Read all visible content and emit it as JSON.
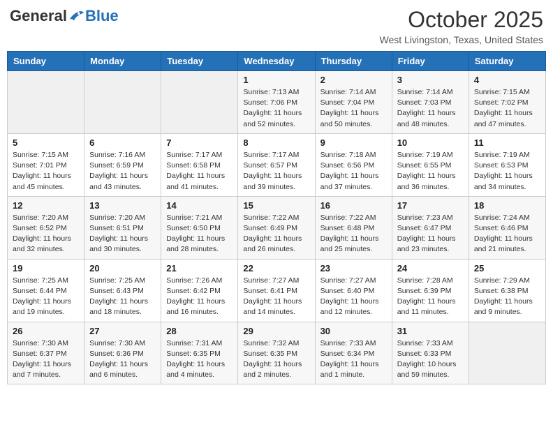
{
  "header": {
    "logo_general": "General",
    "logo_blue": "Blue",
    "month": "October 2025",
    "location": "West Livingston, Texas, United States"
  },
  "weekdays": [
    "Sunday",
    "Monday",
    "Tuesday",
    "Wednesday",
    "Thursday",
    "Friday",
    "Saturday"
  ],
  "weeks": [
    [
      {
        "day": "",
        "info": ""
      },
      {
        "day": "",
        "info": ""
      },
      {
        "day": "",
        "info": ""
      },
      {
        "day": "1",
        "info": "Sunrise: 7:13 AM\nSunset: 7:06 PM\nDaylight: 11 hours and 52 minutes."
      },
      {
        "day": "2",
        "info": "Sunrise: 7:14 AM\nSunset: 7:04 PM\nDaylight: 11 hours and 50 minutes."
      },
      {
        "day": "3",
        "info": "Sunrise: 7:14 AM\nSunset: 7:03 PM\nDaylight: 11 hours and 48 minutes."
      },
      {
        "day": "4",
        "info": "Sunrise: 7:15 AM\nSunset: 7:02 PM\nDaylight: 11 hours and 47 minutes."
      }
    ],
    [
      {
        "day": "5",
        "info": "Sunrise: 7:15 AM\nSunset: 7:01 PM\nDaylight: 11 hours and 45 minutes."
      },
      {
        "day": "6",
        "info": "Sunrise: 7:16 AM\nSunset: 6:59 PM\nDaylight: 11 hours and 43 minutes."
      },
      {
        "day": "7",
        "info": "Sunrise: 7:17 AM\nSunset: 6:58 PM\nDaylight: 11 hours and 41 minutes."
      },
      {
        "day": "8",
        "info": "Sunrise: 7:17 AM\nSunset: 6:57 PM\nDaylight: 11 hours and 39 minutes."
      },
      {
        "day": "9",
        "info": "Sunrise: 7:18 AM\nSunset: 6:56 PM\nDaylight: 11 hours and 37 minutes."
      },
      {
        "day": "10",
        "info": "Sunrise: 7:19 AM\nSunset: 6:55 PM\nDaylight: 11 hours and 36 minutes."
      },
      {
        "day": "11",
        "info": "Sunrise: 7:19 AM\nSunset: 6:53 PM\nDaylight: 11 hours and 34 minutes."
      }
    ],
    [
      {
        "day": "12",
        "info": "Sunrise: 7:20 AM\nSunset: 6:52 PM\nDaylight: 11 hours and 32 minutes."
      },
      {
        "day": "13",
        "info": "Sunrise: 7:20 AM\nSunset: 6:51 PM\nDaylight: 11 hours and 30 minutes."
      },
      {
        "day": "14",
        "info": "Sunrise: 7:21 AM\nSunset: 6:50 PM\nDaylight: 11 hours and 28 minutes."
      },
      {
        "day": "15",
        "info": "Sunrise: 7:22 AM\nSunset: 6:49 PM\nDaylight: 11 hours and 26 minutes."
      },
      {
        "day": "16",
        "info": "Sunrise: 7:22 AM\nSunset: 6:48 PM\nDaylight: 11 hours and 25 minutes."
      },
      {
        "day": "17",
        "info": "Sunrise: 7:23 AM\nSunset: 6:47 PM\nDaylight: 11 hours and 23 minutes."
      },
      {
        "day": "18",
        "info": "Sunrise: 7:24 AM\nSunset: 6:46 PM\nDaylight: 11 hours and 21 minutes."
      }
    ],
    [
      {
        "day": "19",
        "info": "Sunrise: 7:25 AM\nSunset: 6:44 PM\nDaylight: 11 hours and 19 minutes."
      },
      {
        "day": "20",
        "info": "Sunrise: 7:25 AM\nSunset: 6:43 PM\nDaylight: 11 hours and 18 minutes."
      },
      {
        "day": "21",
        "info": "Sunrise: 7:26 AM\nSunset: 6:42 PM\nDaylight: 11 hours and 16 minutes."
      },
      {
        "day": "22",
        "info": "Sunrise: 7:27 AM\nSunset: 6:41 PM\nDaylight: 11 hours and 14 minutes."
      },
      {
        "day": "23",
        "info": "Sunrise: 7:27 AM\nSunset: 6:40 PM\nDaylight: 11 hours and 12 minutes."
      },
      {
        "day": "24",
        "info": "Sunrise: 7:28 AM\nSunset: 6:39 PM\nDaylight: 11 hours and 11 minutes."
      },
      {
        "day": "25",
        "info": "Sunrise: 7:29 AM\nSunset: 6:38 PM\nDaylight: 11 hours and 9 minutes."
      }
    ],
    [
      {
        "day": "26",
        "info": "Sunrise: 7:30 AM\nSunset: 6:37 PM\nDaylight: 11 hours and 7 minutes."
      },
      {
        "day": "27",
        "info": "Sunrise: 7:30 AM\nSunset: 6:36 PM\nDaylight: 11 hours and 6 minutes."
      },
      {
        "day": "28",
        "info": "Sunrise: 7:31 AM\nSunset: 6:35 PM\nDaylight: 11 hours and 4 minutes."
      },
      {
        "day": "29",
        "info": "Sunrise: 7:32 AM\nSunset: 6:35 PM\nDaylight: 11 hours and 2 minutes."
      },
      {
        "day": "30",
        "info": "Sunrise: 7:33 AM\nSunset: 6:34 PM\nDaylight: 11 hours and 1 minute."
      },
      {
        "day": "31",
        "info": "Sunrise: 7:33 AM\nSunset: 6:33 PM\nDaylight: 10 hours and 59 minutes."
      },
      {
        "day": "",
        "info": ""
      }
    ]
  ]
}
